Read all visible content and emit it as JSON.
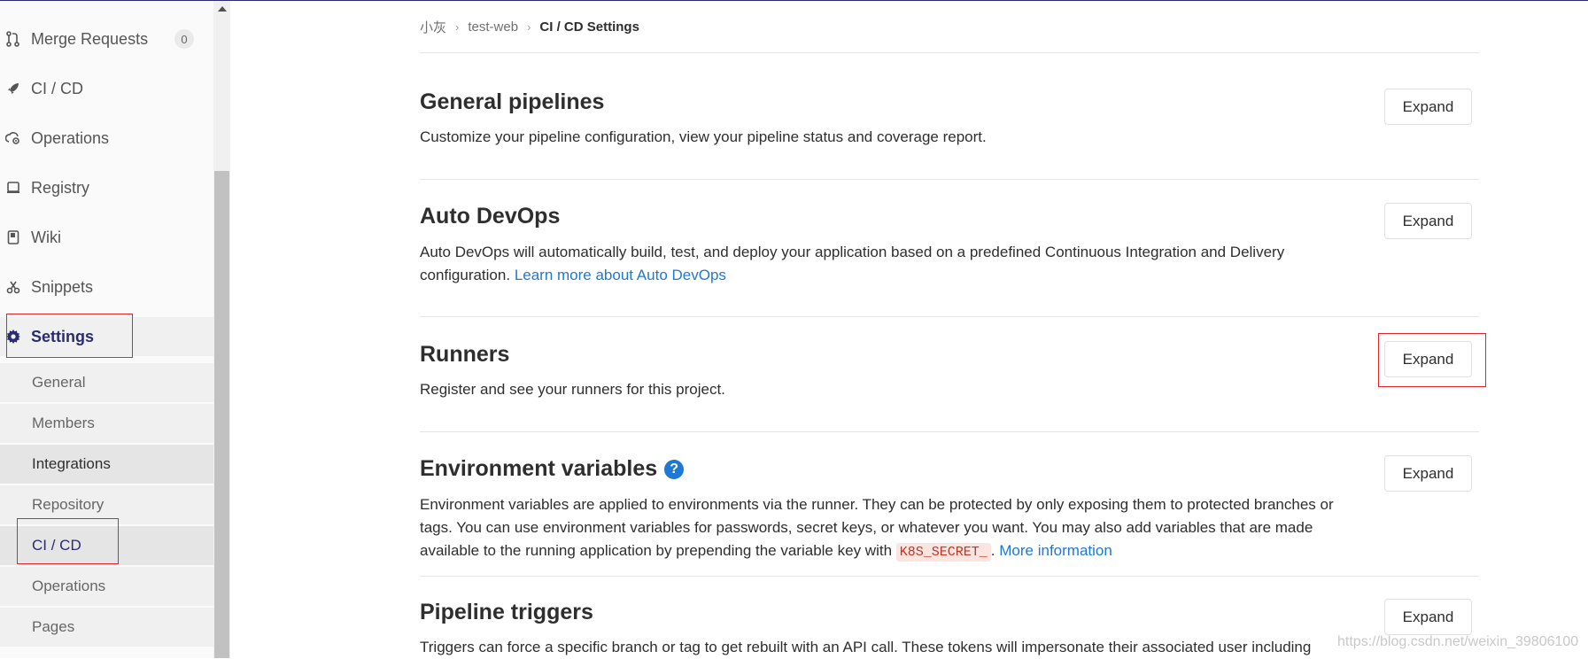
{
  "sidebar": {
    "items": [
      {
        "label": "Merge Requests",
        "badge": "0",
        "icon": "merge-request-icon"
      },
      {
        "label": "CI / CD",
        "icon": "rocket-icon"
      },
      {
        "label": "Operations",
        "icon": "cloud-gear-icon"
      },
      {
        "label": "Registry",
        "icon": "registry-icon"
      },
      {
        "label": "Wiki",
        "icon": "book-icon"
      },
      {
        "label": "Snippets",
        "icon": "scissors-icon"
      },
      {
        "label": "Settings",
        "icon": "gear-icon"
      }
    ],
    "settings_sub": [
      "General",
      "Members",
      "Integrations",
      "Repository",
      "CI / CD",
      "Operations",
      "Pages"
    ]
  },
  "breadcrumb": {
    "items": [
      "小灰",
      "test-web",
      "CI / CD Settings"
    ],
    "separator": "›"
  },
  "sections": [
    {
      "title": "General pipelines",
      "desc": "Customize your pipeline configuration, view your pipeline status and coverage report.",
      "button": "Expand"
    },
    {
      "title": "Auto DevOps",
      "desc": "Auto DevOps will automatically build, test, and deploy your application based on a predefined Continuous Integration and Delivery configuration.",
      "link": "Learn more about Auto DevOps",
      "button": "Expand"
    },
    {
      "title": "Runners",
      "desc": "Register and see your runners for this project.",
      "button": "Expand"
    },
    {
      "title": "Environment variables",
      "desc": "Environment variables are applied to environments via the runner. They can be protected by only exposing them to protected branches or tags. You can use environment variables for passwords, secret keys, or whatever you want. You may also add variables that are made available to the running application by prepending the variable key with",
      "code": "K8S_SECRET_",
      "desc_end": ".",
      "link": "More information",
      "button": "Expand"
    },
    {
      "title": "Pipeline triggers",
      "desc": "Triggers can force a specific branch or tag to get rebuilt with an API call. These tokens will impersonate their associated user including",
      "button": "Expand"
    }
  ],
  "watermark": "https://blog.csdn.net/weixin_39806100",
  "colors": {
    "accent": "#2b2b6e",
    "link": "#1f78d1",
    "highlight": "#e0252b"
  }
}
